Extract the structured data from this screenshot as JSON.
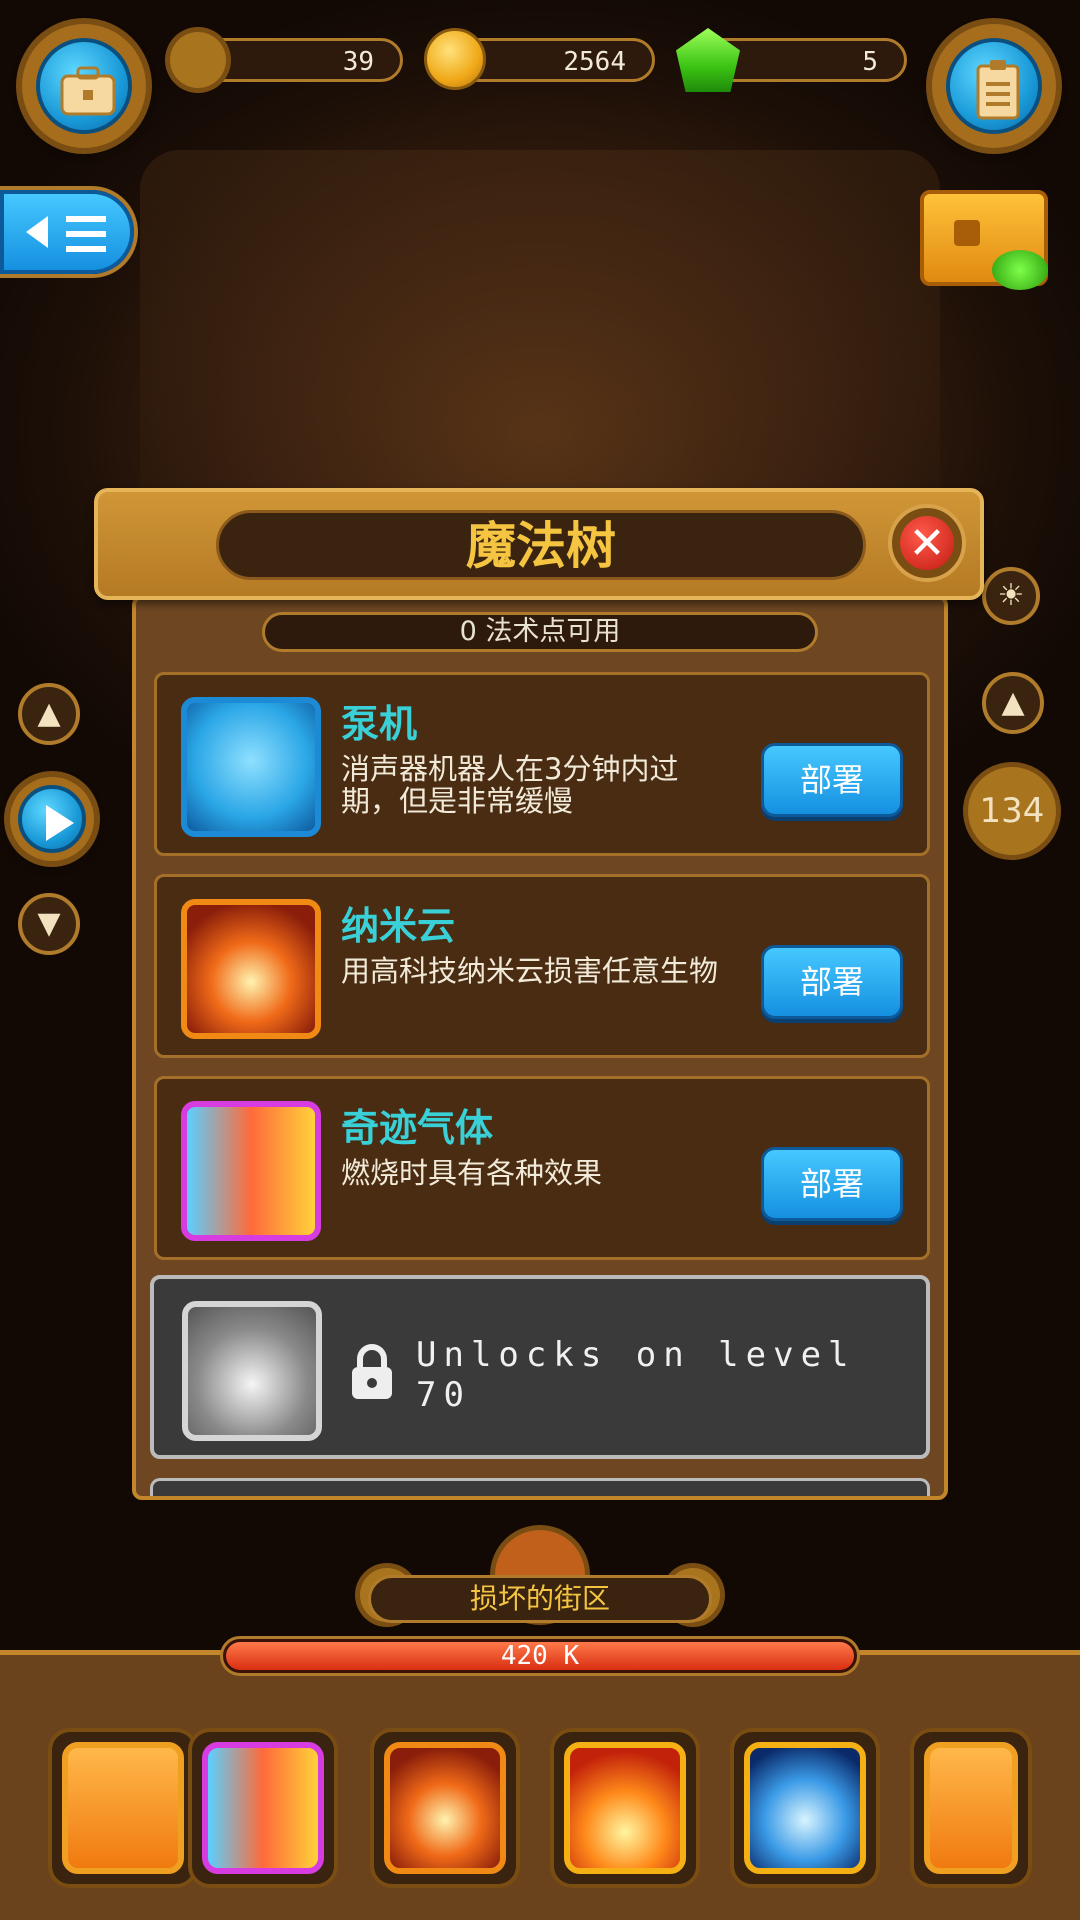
{
  "resources": {
    "gears": "39",
    "coins": "2564",
    "gems": "5"
  },
  "level_badge": "134",
  "dialog": {
    "title": "魔法树",
    "points_text": "0 法术点可用",
    "spells": [
      {
        "name": "泵机",
        "desc": "消声器机器人在3分钟内过期，但是非常缓慢",
        "button": "部署",
        "icon": "robot-icon",
        "color": "#2a9ee6"
      },
      {
        "name": "纳米云",
        "desc": "用高科技纳米云损害任意生物",
        "button": "部署",
        "icon": "nano-cloud-icon",
        "color": "#f08a14"
      },
      {
        "name": "奇迹气体",
        "desc": "燃烧时具有各种效果",
        "button": "部署",
        "icon": "miracle-gas-icon",
        "color": "#d63ce0"
      }
    ],
    "locked": {
      "text": "Unlocks on level 70",
      "icon": "lightning-icon"
    }
  },
  "area": {
    "name": "损坏的街区",
    "hp": "420 K",
    "hp_fraction": 1.0
  },
  "colors": {
    "accent": "#f5c542",
    "deploy": "#1d9ae6",
    "spell_name": "#39d0d8"
  }
}
